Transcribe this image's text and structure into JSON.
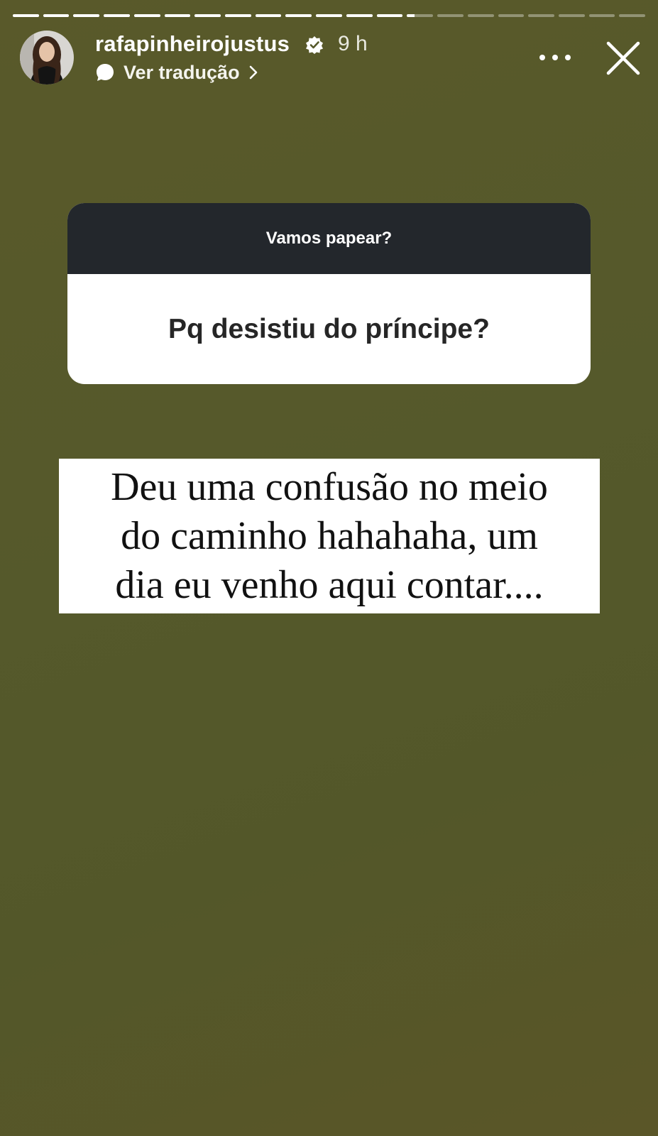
{
  "story": {
    "progress_segments": [
      1,
      1,
      1,
      1,
      1,
      1,
      1,
      1,
      1,
      1,
      1,
      1,
      1,
      0.3,
      0,
      0,
      0,
      0,
      0,
      0,
      0
    ],
    "username": "rafapinheirojustus",
    "time_ago": "9 h",
    "translate_label": "Ver tradução",
    "verified": true,
    "colors": {
      "background": "#56582a",
      "question_header": "#23272c"
    }
  },
  "icons": {
    "verified": "verified-badge-icon",
    "translate": "speech-bubble-icon",
    "chevron": "chevron-right-icon",
    "more": "more-options-icon",
    "close": "close-icon"
  },
  "question_sticker": {
    "header": "Vamos papear?",
    "question": "Pq desistiu do príncipe?"
  },
  "answer_text": {
    "lines": [
      "Deu uma confusão no meio",
      "do caminho hahahaha, um",
      "dia eu venho aqui contar...."
    ]
  }
}
